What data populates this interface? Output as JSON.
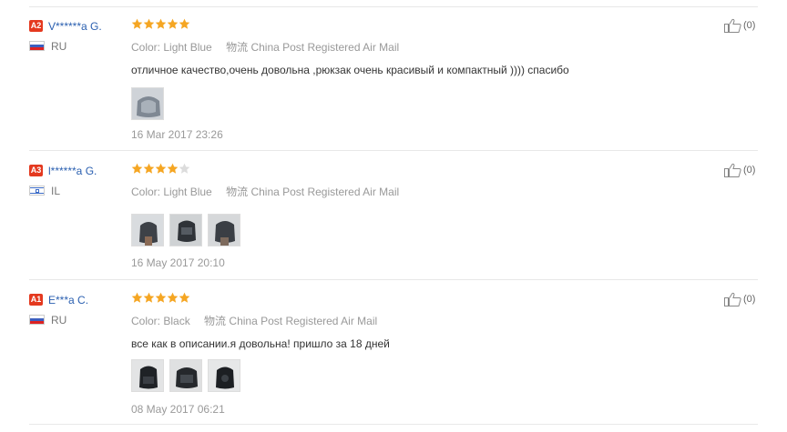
{
  "colors": {
    "star_filled": "#f5a623",
    "star_empty": "#dcdcdc",
    "level_badge": "#e4391f",
    "user_name": "#2a5fb0"
  },
  "labels": {
    "color_label": "Color:",
    "shipping_label": "物流"
  },
  "reviews": [
    {
      "level": "A2",
      "user": "V******a G.",
      "country_flag": "ru-flag-icon",
      "country": "RU",
      "rating": 5,
      "color": "Light Blue",
      "shipping": "China Post Registered Air Mail",
      "text": "отличное качество,очень довольна ,рюкзак очень красивый и компактный )))) спасибо",
      "photos": [
        "photo-thumbnail"
      ],
      "date": "16 Mar 2017 23:26",
      "helpful_count": "(0)"
    },
    {
      "level": "A3",
      "user": "l******a G.",
      "country_flag": "il-flag-icon",
      "country": "IL",
      "rating": 4,
      "color": "Light Blue",
      "shipping": "China Post Registered Air Mail",
      "text": "",
      "photos": [
        "photo-thumbnail",
        "photo-thumbnail",
        "photo-thumbnail"
      ],
      "date": "16 May 2017 20:10",
      "helpful_count": "(0)"
    },
    {
      "level": "A1",
      "user": "E***a C.",
      "country_flag": "ru-flag-icon",
      "country": "RU",
      "rating": 5,
      "color": "Black",
      "shipping": "China Post Registered Air Mail",
      "text": "все как в описании.я довольна! пришло за 18 дней",
      "photos": [
        "photo-thumbnail",
        "photo-thumbnail",
        "photo-thumbnail"
      ],
      "date": "08 May 2017 06:21",
      "helpful_count": "(0)"
    }
  ]
}
